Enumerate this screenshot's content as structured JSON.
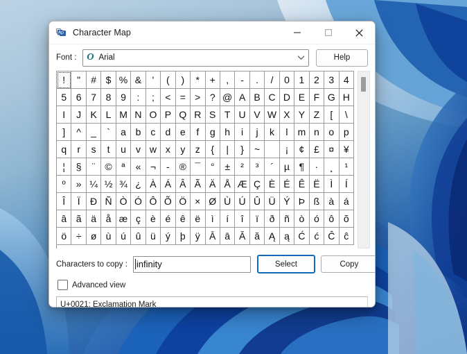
{
  "window": {
    "title": "Character Map",
    "icon": "character-map-icon",
    "controls": {
      "minimize": "minimize-icon",
      "maximize": "maximize-icon",
      "close": "close-icon"
    }
  },
  "font_row": {
    "label": "Font :",
    "font_type_icon": "O",
    "font_name": "Arial",
    "dropdown_icon": "chevron-down-icon",
    "help_label": "Help"
  },
  "grid": {
    "columns": 20,
    "focused_index": 0,
    "scroll_thumb_position": "near-top",
    "rows": [
      [
        "!",
        "\"",
        "#",
        "$",
        "%",
        "&",
        "'",
        "(",
        ")",
        "*",
        "+",
        ",",
        "-",
        ".",
        "/",
        "0",
        "1",
        "2",
        "3",
        "4"
      ],
      [
        "5",
        "6",
        "7",
        "8",
        "9",
        ":",
        ";",
        "<",
        "=",
        ">",
        "?",
        "@",
        "A",
        "B",
        "C",
        "D",
        "E",
        "F",
        "G",
        "H"
      ],
      [
        "I",
        "J",
        "K",
        "L",
        "M",
        "N",
        "O",
        "P",
        "Q",
        "R",
        "S",
        "T",
        "U",
        "V",
        "W",
        "X",
        "Y",
        "Z",
        "[",
        "\\"
      ],
      [
        "]",
        "^",
        "_",
        "`",
        "a",
        "b",
        "c",
        "d",
        "e",
        "f",
        "g",
        "h",
        "i",
        "j",
        "k",
        "l",
        "m",
        "n",
        "o",
        "p"
      ],
      [
        "q",
        "r",
        "s",
        "t",
        "u",
        "v",
        "w",
        "x",
        "y",
        "z",
        "{",
        "|",
        "}",
        "~",
        " ",
        "¡",
        "¢",
        "£",
        "¤",
        "¥"
      ],
      [
        "¦",
        "§",
        "¨",
        "©",
        "ª",
        "«",
        "¬",
        "-",
        "®",
        "¯",
        "°",
        "±",
        "²",
        "³",
        "´",
        "µ",
        "¶",
        "·",
        "¸",
        "¹"
      ],
      [
        "º",
        "»",
        "¼",
        "½",
        "¾",
        "¿",
        "À",
        "Á",
        "Â",
        "Ã",
        "Ä",
        "Å",
        "Æ",
        "Ç",
        "È",
        "É",
        "Ê",
        "Ë",
        "Ì",
        "Í"
      ],
      [
        "Î",
        "Ï",
        "Ð",
        "Ñ",
        "Ò",
        "Ó",
        "Ô",
        "Õ",
        "Ö",
        "×",
        "Ø",
        "Ù",
        "Ú",
        "Û",
        "Ü",
        "Ý",
        "Þ",
        "ß",
        "à",
        "á"
      ],
      [
        "â",
        "ã",
        "ä",
        "å",
        "æ",
        "ç",
        "è",
        "é",
        "ê",
        "ë",
        "ì",
        "í",
        "î",
        "ï",
        "ð",
        "ñ",
        "ò",
        "ó",
        "ô",
        "õ"
      ],
      [
        "ö",
        "÷",
        "ø",
        "ù",
        "ú",
        "û",
        "ü",
        "ý",
        "þ",
        "ÿ",
        "Ā",
        "ā",
        "Ă",
        "ă",
        "Ą",
        "ą",
        "Ć",
        "ć",
        "Ĉ",
        "ĉ"
      ]
    ]
  },
  "copy_row": {
    "label": "Characters to copy :",
    "value": "infinity",
    "placeholder": "",
    "select_label": "Select",
    "copy_label": "Copy"
  },
  "advanced": {
    "label": "Advanced view",
    "checked": false
  },
  "status": {
    "text": "U+0021: Exclamation Mark"
  },
  "colors": {
    "accent_focus": "#0f6cbd",
    "window_bg": "#ffffff",
    "grid_line": "#9a9a9a",
    "desktop_blue": "#0b2f7e"
  }
}
